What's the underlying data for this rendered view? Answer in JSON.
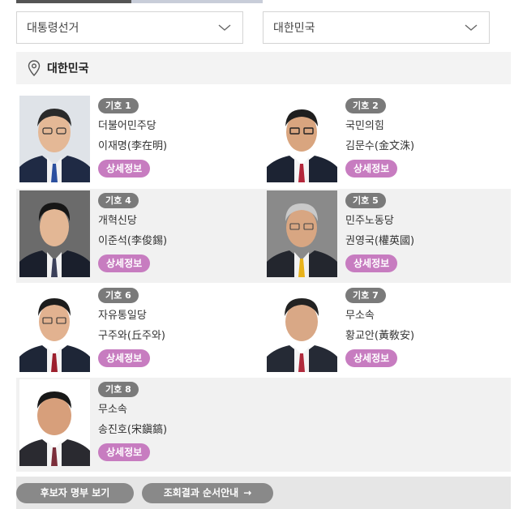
{
  "filters": {
    "election": "대통령선거",
    "region": "대한민국"
  },
  "region_bar": {
    "label": "대한민국"
  },
  "candidates": [
    {
      "number": "기호 1",
      "party": "더불어민주당",
      "name": "이재명(李在明)",
      "detail": "상세정보"
    },
    {
      "number": "기호 2",
      "party": "국민의힘",
      "name": "김문수(金文洙)",
      "detail": "상세정보"
    },
    {
      "number": "기호 4",
      "party": "개혁신당",
      "name": "이준석(李俊錫)",
      "detail": "상세정보"
    },
    {
      "number": "기호 5",
      "party": "민주노동당",
      "name": "권영국(權英國)",
      "detail": "상세정보"
    },
    {
      "number": "기호 6",
      "party": "자유통일당",
      "name": "구주와(丘주와)",
      "detail": "상세정보"
    },
    {
      "number": "기호 7",
      "party": "무소속",
      "name": "황교안(黃敎安)",
      "detail": "상세정보"
    },
    {
      "number": "기호 8",
      "party": "무소속",
      "name": "송진호(宋鎭鎬)",
      "detail": "상세정보"
    }
  ],
  "footer": {
    "list_button": "후보자 명부 보기",
    "guide_button": "조회결과 순서안내",
    "guide_arrow": "→"
  },
  "colors": {
    "detail_button": "#c77cc0",
    "badge": "#7a7a7a",
    "row_shade": "#f1f1f1"
  }
}
